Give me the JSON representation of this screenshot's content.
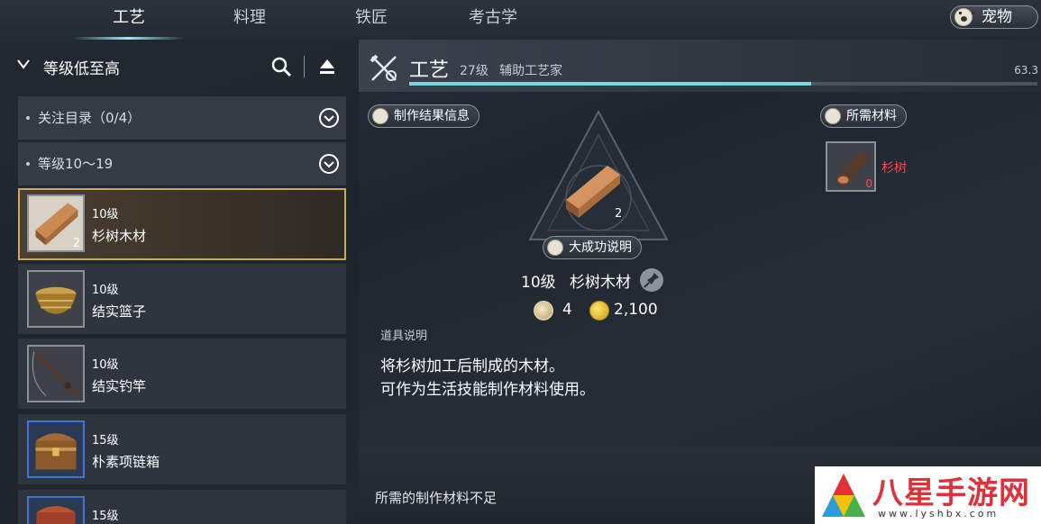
{
  "tabs": [
    {
      "label": "工艺",
      "active": true
    },
    {
      "label": "料理",
      "active": false
    },
    {
      "label": "铁匠",
      "active": false
    },
    {
      "label": "考古学",
      "active": false
    }
  ],
  "pet_button": {
    "label": "宠物",
    "icon": "paw-icon"
  },
  "list": {
    "sort_label": "等级低至高",
    "groups": [
      {
        "label": "关注目录（0/4）"
      },
      {
        "label": "等级10～19"
      }
    ],
    "items": [
      {
        "level": "10级",
        "name": "杉树木材",
        "qty": "2",
        "selected": true
      },
      {
        "level": "10级",
        "name": "结实篮子"
      },
      {
        "level": "10级",
        "name": "结实钓竿"
      },
      {
        "level": "15级",
        "name": "朴素项链箱"
      },
      {
        "level": "15级",
        "name": ""
      }
    ]
  },
  "skill": {
    "title": "工艺",
    "level": "27级",
    "rank": "辅助工艺家",
    "percent_text": "63.3",
    "progress": 0.64
  },
  "result": {
    "section_label": "制作结果信息",
    "qty": "2",
    "great_success_label": "大成功说明",
    "level": "10级",
    "name": "杉树木材",
    "cost_points": "4",
    "cost_gold": "2,100"
  },
  "materials": {
    "section_label": "所需材料",
    "items": [
      {
        "name": "杉树",
        "qty": "0"
      }
    ]
  },
  "description": {
    "heading": "道具说明",
    "line1": "将杉树加工后制成的木材。",
    "line2": "可作为生活技能制作材料使用。"
  },
  "footer": {
    "message": "所需的制作材料不足"
  },
  "watermark": {
    "text": "八星手游网",
    "url": "www.lyshbx.com"
  },
  "colors": {
    "accent": "#7fd4dd",
    "selected_border": "#c9a862",
    "insufficient": "#ff4a4a"
  }
}
